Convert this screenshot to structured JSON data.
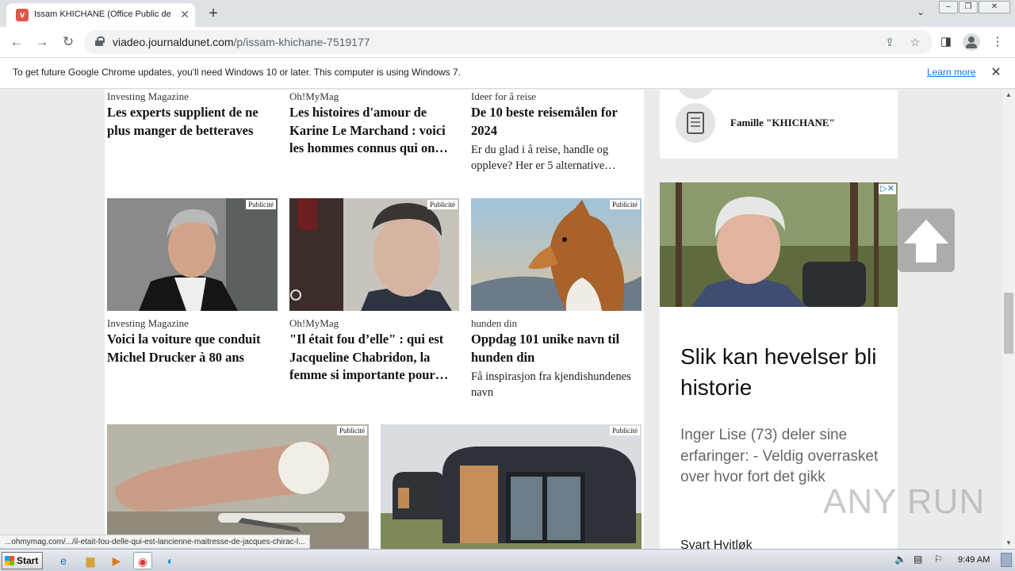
{
  "browser": {
    "tab_title": "Issam KHICHANE (Office Public de Tr",
    "tab_close": "✕",
    "new_tab": "+",
    "url_domain": "viadeo.journaldunet.com",
    "url_path": "/p/issam-khichane-7519177"
  },
  "infobar": {
    "message": "To get future Google Chrome updates, you'll need Windows 10 or later. This computer is using Windows 7.",
    "learn_more": "Learn more"
  },
  "articles": [
    {
      "source": "Investing Magazine",
      "title": "Les experts supplient de ne plus manger de betteraves",
      "desc": ""
    },
    {
      "source": "Oh!MyMag",
      "title": "Les histoires d'amour de Karine Le Marchand : voici les hommes connus qui on…",
      "desc": ""
    },
    {
      "source": "Ideer for å reise",
      "title": "De 10 beste reisemålen for 2024",
      "desc": "Er du glad i å reise, handle og oppleve? Her er 5 alternative…"
    },
    {
      "source": "Investing Magazine",
      "title": "Voici la voiture que conduit Michel Drucker à 80 ans",
      "desc": "",
      "badge": "Publicité"
    },
    {
      "source": "Oh!MyMag",
      "title": "\"Il était fou d’elle\" : qui est Jacqueline Chabridon, la femme si importante pour…",
      "desc": "",
      "badge": "Publicité"
    },
    {
      "source": "hunden din",
      "title": "Oppdag 101 unike navn til hunden din",
      "desc": "Få inspirasjon fra kjendishundenes navn",
      "badge": "Publicité"
    },
    {
      "badge": "Publicité"
    },
    {
      "badge": "Publicité"
    }
  ],
  "sidebar": {
    "family_label": "Famille \"KHICHANE\""
  },
  "ad": {
    "title": "Slik kan hevelser bli historie",
    "text": "Inger Lise (73) deler sine erfaringer: - Veldig overrasket over hvor fort det gikk",
    "brand": "Svart Hvitløk"
  },
  "status_bar_url": "...ohmymag.com/.../il-etait-fou-delle-qui-est-lancienne-maitresse-de-jacques-chirac-l...",
  "watermark": "ANY RUN",
  "taskbar": {
    "start": "Start",
    "clock": "9:49 AM"
  }
}
